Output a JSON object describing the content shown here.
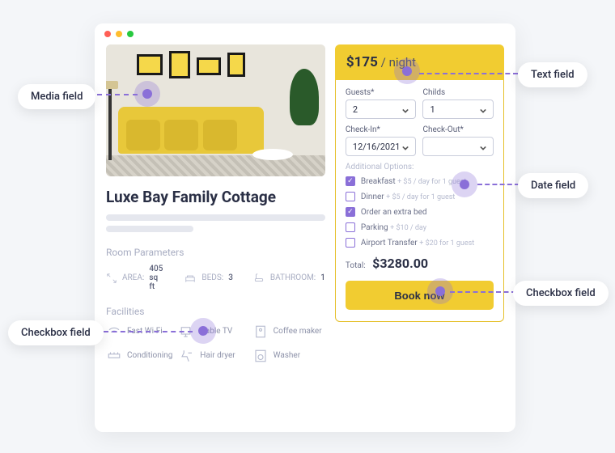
{
  "annotations": {
    "media": "Media field",
    "text": "Text field",
    "date": "Date field",
    "checkbox_right": "Checkbox field",
    "checkbox_left": "Checkbox field"
  },
  "listing": {
    "title": "Luxe Bay Family Cottage",
    "price": "$175",
    "price_unit": " / night"
  },
  "form": {
    "guests_label": "Guests*",
    "guests_value": "2",
    "childs_label": "Childs",
    "childs_value": "1",
    "checkin_label": "Check-In*",
    "checkin_value": "12/16/2021",
    "checkout_label": "Check-Out*",
    "checkout_value": "",
    "additional_label": "Additional Options:",
    "total_label": "Total:",
    "total_value": "$3280.00",
    "book_label": "Book now"
  },
  "options": [
    {
      "name": "Breakfast",
      "price": "+ $5 / day for 1 guest",
      "checked": true
    },
    {
      "name": "Dinner",
      "price": "+ $5 / day for 1 guest",
      "checked": false
    },
    {
      "name": "Order an extra bed",
      "price": "",
      "checked": true
    },
    {
      "name": "Parking",
      "price": "+ $10 / day",
      "checked": false
    },
    {
      "name": "Airport Transfer",
      "price": "+ $20 for 1 guest",
      "checked": false
    }
  ],
  "params": {
    "section_label": "Room Parameters",
    "area_label": "AREA:",
    "area_value": "405 sq ft",
    "beds_label": "BEDS:",
    "beds_value": "3",
    "bath_label": "BATHROOM:",
    "bath_value": "1"
  },
  "facilities": {
    "section_label": "Facilities",
    "items": [
      "Fast Wi-Fi",
      "Cable TV",
      "Coffee maker",
      "Conditioning",
      "Hair dryer",
      "Washer"
    ]
  },
  "colors": {
    "accent": "#8a6fd8",
    "yellow": "#f1cc31"
  }
}
